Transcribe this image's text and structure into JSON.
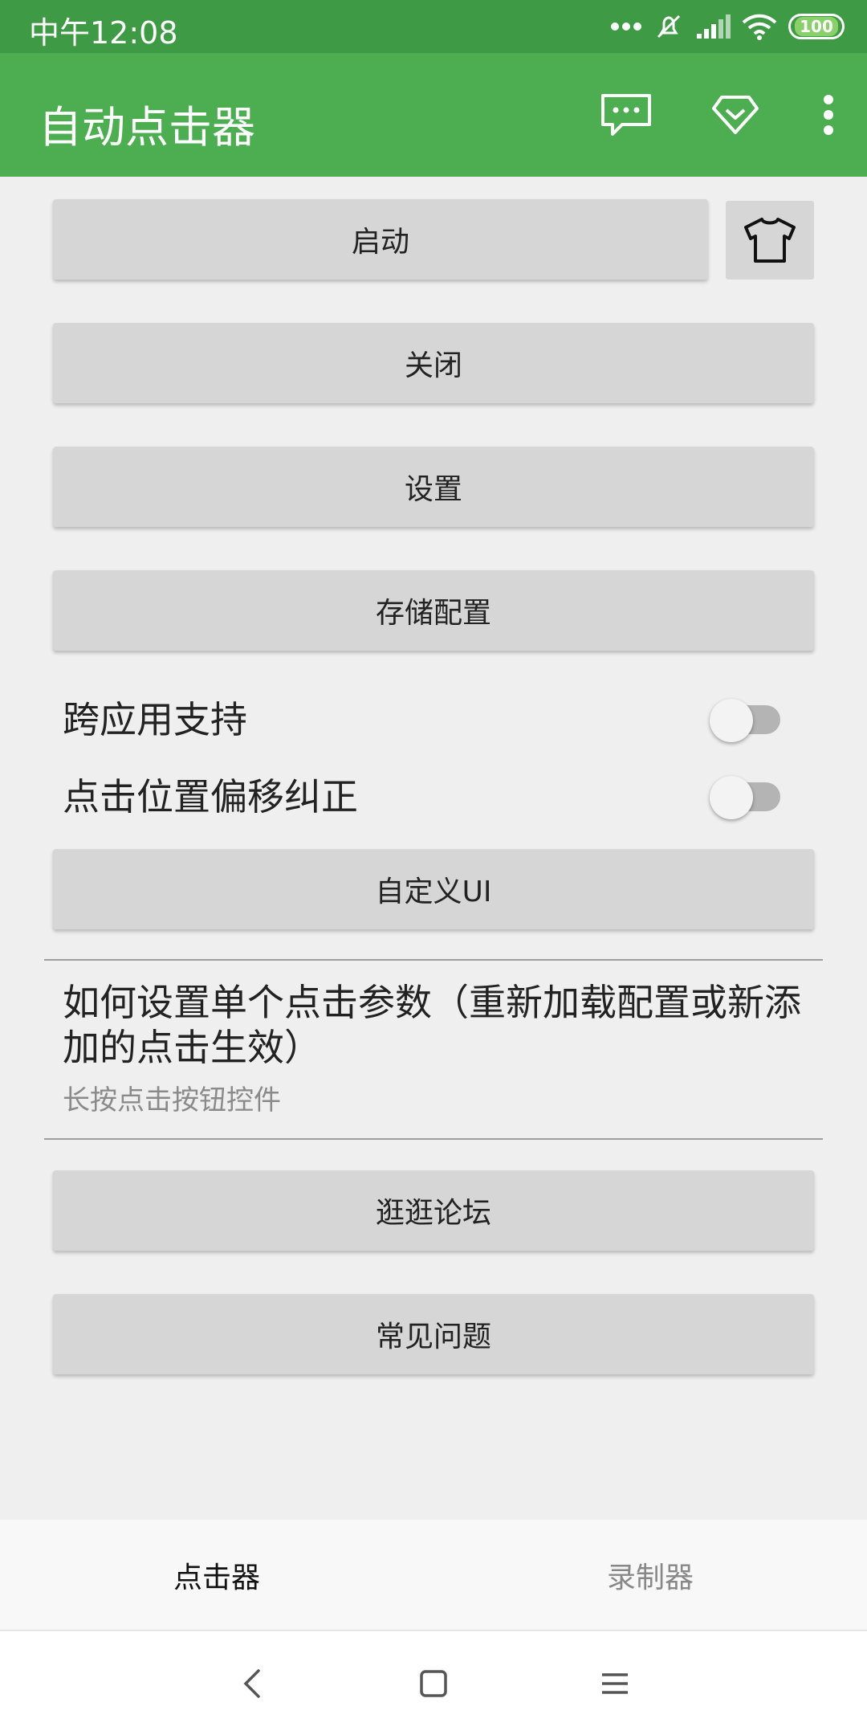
{
  "status_bar": {
    "time": "中午12:08",
    "battery": "100"
  },
  "app_bar": {
    "title": "自动点击器"
  },
  "buttons": {
    "start": "启动",
    "close": "关闭",
    "settings": "设置",
    "save_config": "存储配置",
    "custom_ui": "自定义UI",
    "forum": "逛逛论坛",
    "faq": "常见问题"
  },
  "toggles": {
    "cross_app": {
      "label": "跨应用支持",
      "on": false
    },
    "offset_fix": {
      "label": "点击位置偏移纠正",
      "on": false
    }
  },
  "preference": {
    "title": "如何设置单个点击参数（重新加载配置或新添加的点击生效）",
    "summary": "长按点击按钮控件"
  },
  "bottom_nav": {
    "clicker": "点击器",
    "recorder": "录制器"
  },
  "colors": {
    "status_bar": "#3f9a45",
    "app_bar": "#4cae50",
    "button": "#d6d6d6",
    "background": "#efefef"
  },
  "icons": [
    "message-icon",
    "diamond-icon",
    "more-vert-icon",
    "shirt-icon",
    "back-icon",
    "home-icon",
    "menu-icon"
  ]
}
